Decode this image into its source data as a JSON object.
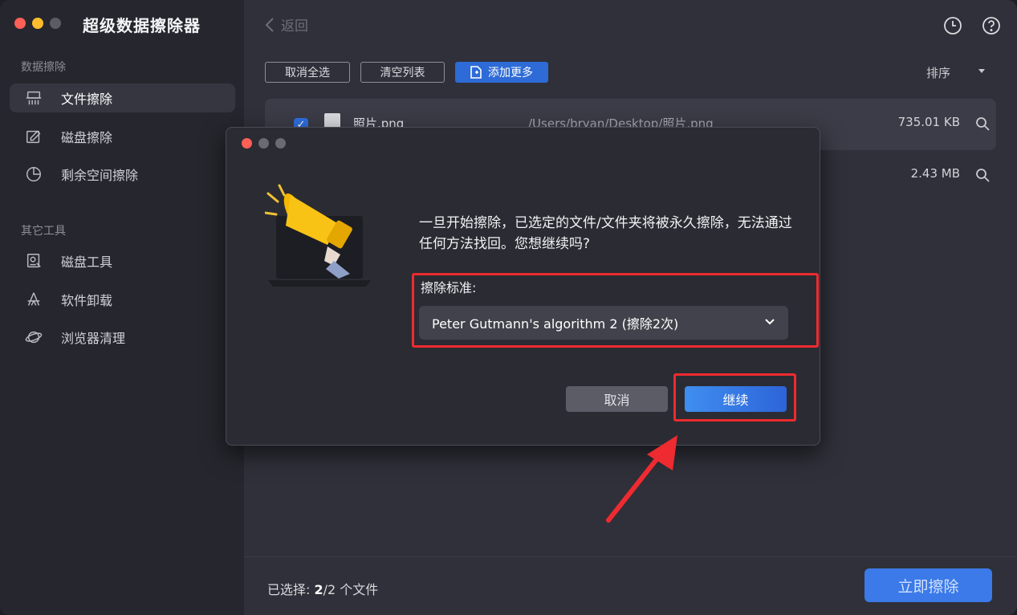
{
  "app": {
    "title": "超级数据擦除器"
  },
  "sidebar": {
    "section_data": "数据擦除",
    "section_tools": "其它工具",
    "items": [
      {
        "label": "文件擦除",
        "icon": "shredder-icon",
        "active": true
      },
      {
        "label": "磁盘擦除",
        "icon": "disk-erase-icon",
        "active": false
      },
      {
        "label": "剩余空间擦除",
        "icon": "pie-chart-icon",
        "active": false
      },
      {
        "label": "磁盘工具",
        "icon": "disk-tool-icon",
        "active": false
      },
      {
        "label": "软件卸载",
        "icon": "app-uninstall-icon",
        "active": false
      },
      {
        "label": "浏览器清理",
        "icon": "planet-icon",
        "active": false
      }
    ]
  },
  "topbar": {
    "back_label": "返回",
    "history_icon": "clock-icon",
    "help_icon": "question-icon"
  },
  "toolbar": {
    "deselect_all": "取消全选",
    "clear_list": "清空列表",
    "add_more": "添加更多",
    "sort": "排序"
  },
  "files": [
    {
      "name": "照片.png",
      "path": "/Users/bryan/Desktop/照片.png",
      "size": "735.01 KB",
      "checked": true
    },
    {
      "name": "",
      "path": "",
      "size": "2.43 MB",
      "checked": true
    }
  ],
  "footer": {
    "selected_prefix": "已选择: ",
    "selected_count": "2",
    "selected_suffix": "/2 个文件",
    "wipe_now": "立即擦除"
  },
  "dialog": {
    "message": "一旦开始擦除，已选定的文件/文件夹将被永久擦除，无法通过任何方法找回。您想继续吗?",
    "standard_label": "擦除标准:",
    "standard_value": "Peter Gutmann's algorithm 2 (擦除2次)",
    "cancel": "取消",
    "continue": "继续"
  },
  "colors": {
    "accent": "#2e6bd6",
    "highlight": "#ee2b30"
  }
}
